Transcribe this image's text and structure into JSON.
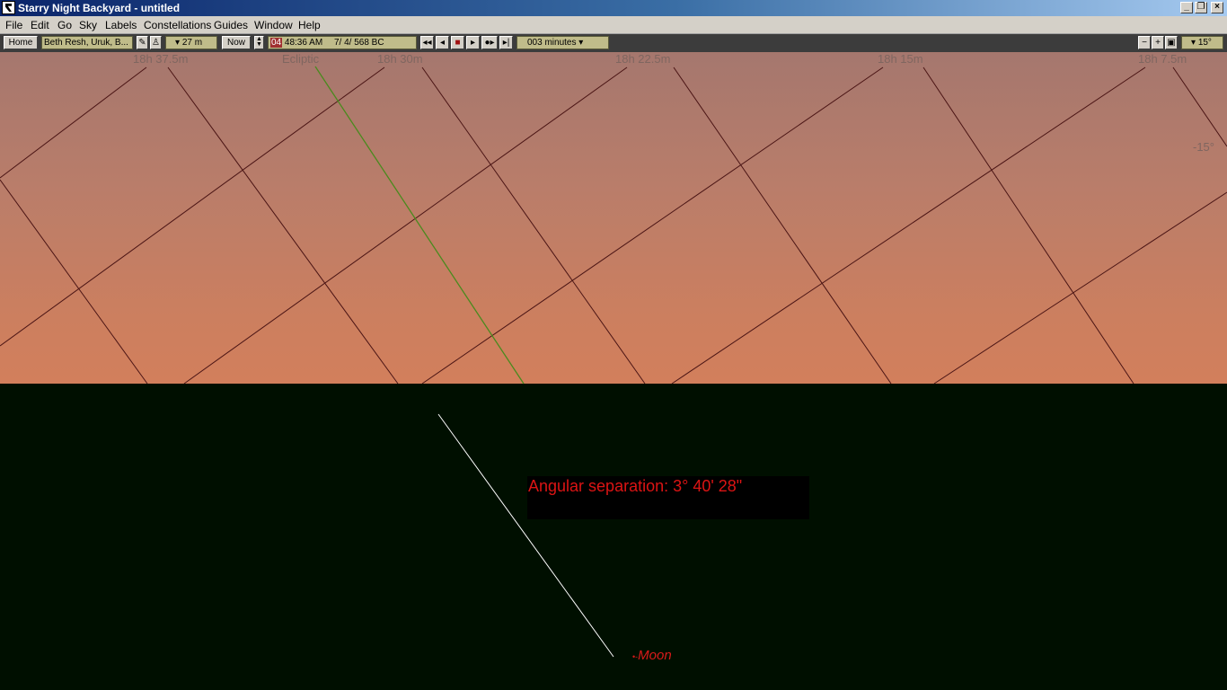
{
  "window": {
    "title": "Starry Night Backyard - untitled"
  },
  "menu": [
    "File",
    "Edit",
    "Go",
    "Sky",
    "Labels",
    "Constellations",
    "Guides",
    "Window",
    "Help"
  ],
  "toolbar": {
    "home": "Home",
    "location": "Beth Resh, Uruk, B...",
    "elevation": "27 m",
    "now": "Now",
    "time_hour": "04",
    "time_rest": "48:36 AM",
    "date": "7/  4/  568 BC",
    "time_step": "003 minutes",
    "fov": "15°"
  },
  "sky": {
    "grid_labels": [
      "18h 37.5m",
      "Ecliptic",
      "18h 30m",
      "18h 22.5m",
      "18h 15m",
      "18h 7.5m",
      "-15°"
    ]
  },
  "measurement": {
    "angular_separation": "Angular separation: 3° 40' 28\""
  },
  "objects": {
    "moon_label": "Moon"
  },
  "colors": {
    "sky_top": "#a5776e",
    "sky_bottom": "#d27f5c",
    "ground": "#000f00",
    "grid_line": "#4a1414",
    "ecliptic": "#4a8a1e",
    "measure_line": "#ffffff",
    "label_red": "#dc1414"
  }
}
